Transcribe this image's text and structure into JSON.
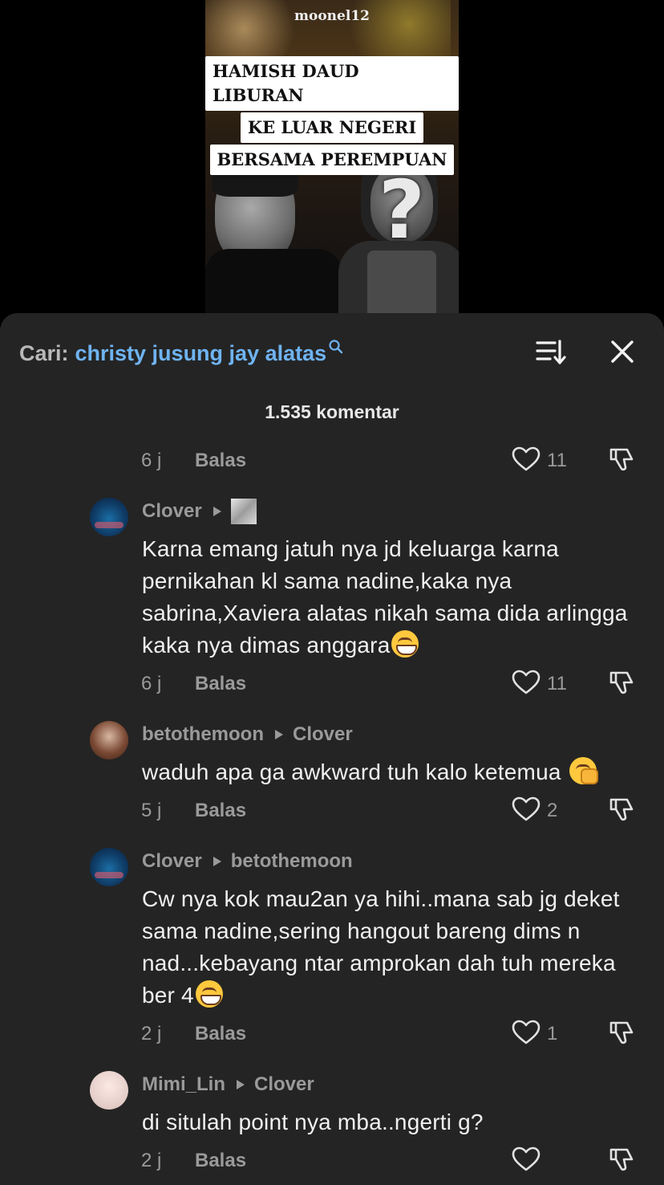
{
  "video": {
    "watermark": "moonel12",
    "headline_lines": [
      "HAMISH DAUD LIBURAN",
      "KE LUAR NEGERI",
      "BERSAMA PEREMPUAN"
    ],
    "question_mark": "?"
  },
  "search": {
    "prefix": "Cari:",
    "term": "christy jusung jay alatas"
  },
  "comment_count": "1.535 komentar",
  "colors": {
    "sheet": "#242424",
    "link": "#6fb3f2",
    "muted": "#9a9a9a"
  },
  "icons": [
    "search-icon",
    "sort-icon",
    "close-icon",
    "heart-icon",
    "dislike-icon",
    "reply-arrow-icon"
  ],
  "reply_label": "Balas",
  "comments": [
    {
      "time": "6 j",
      "likes": "11"
    },
    {
      "author": "Clover",
      "text": "Karna emang jatuh nya jd keluarga karna pernikahan kl sama nadine,kaka nya sabrina,Xaviera alatas nikah sama dida arlingga kaka nya dimas anggara",
      "time": "6 j",
      "likes": "11"
    },
    {
      "author": "betothemoon",
      "reply_to": "Clover",
      "text": "waduh apa ga awkward tuh kalo ketemua",
      "time": "5 j",
      "likes": "2"
    },
    {
      "author": "Clover",
      "reply_to": "betothemoon",
      "text": "Cw nya kok mau2an ya hihi..mana sab jg deket sama nadine,sering hangout bareng dims n nad...kebayang ntar amprokan dah tuh mereka ber 4",
      "time": "2 j",
      "likes": "1"
    },
    {
      "author": "Mimi_Lin",
      "reply_to": "Clover",
      "text": "di situlah point nya mba..ngerti g?",
      "time": "2 j",
      "likes": ""
    }
  ]
}
